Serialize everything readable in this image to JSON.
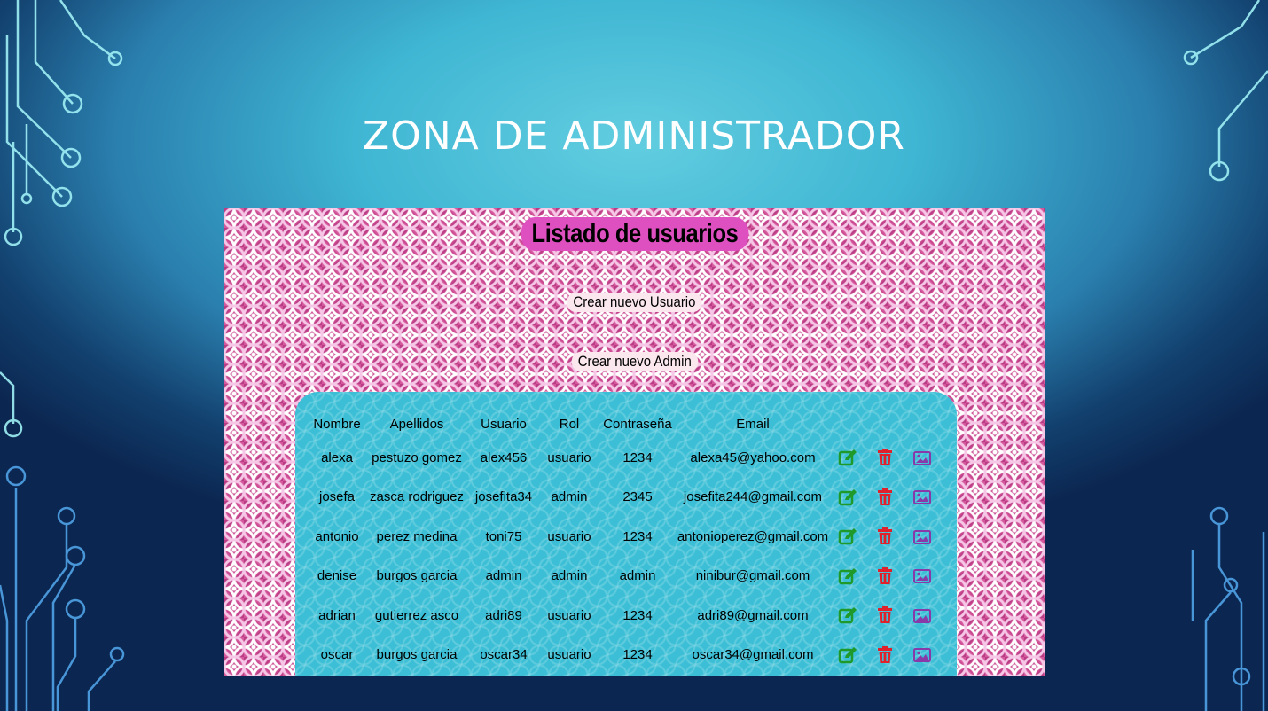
{
  "slide": {
    "title": "ZONA DE ADMINISTRADOR"
  },
  "page": {
    "heading": "Listado de usuarios",
    "create_user_label": "Crear nuevo Usuario",
    "create_admin_label": "Crear nuevo Admin"
  },
  "table": {
    "headers": {
      "nombre": "Nombre",
      "apellidos": "Apellidos",
      "usuario": "Usuario",
      "rol": "Rol",
      "contrasena": "Contraseña",
      "email": "Email"
    },
    "rows": [
      {
        "nombre": "alexa",
        "apellidos": "pestuzo gomez",
        "usuario": "alex456",
        "rol": "usuario",
        "contrasena": "1234",
        "email": "alexa45@yahoo.com"
      },
      {
        "nombre": "josefa",
        "apellidos": "zasca rodriguez",
        "usuario": "josefita34",
        "rol": "admin",
        "contrasena": "2345",
        "email": "josefita244@gmail.com"
      },
      {
        "nombre": "antonio",
        "apellidos": "perez medina",
        "usuario": "toni75",
        "rol": "usuario",
        "contrasena": "1234",
        "email": "antonioperez@gmail.com"
      },
      {
        "nombre": "denise",
        "apellidos": "burgos garcia",
        "usuario": "admin",
        "rol": "admin",
        "contrasena": "admin",
        "email": "ninibur@gmail.com"
      },
      {
        "nombre": "adrian",
        "apellidos": "gutierrez asco",
        "usuario": "adri89",
        "rol": "usuario",
        "contrasena": "1234",
        "email": "adri89@gmail.com"
      },
      {
        "nombre": "oscar",
        "apellidos": "burgos garcia",
        "usuario": "oscar34",
        "rol": "usuario",
        "contrasena": "1234",
        "email": "oscar34@gmail.com"
      }
    ],
    "row_actions": [
      "edit-icon",
      "trash-icon",
      "image-icon"
    ]
  },
  "colors": {
    "edit": "#1f9a2a",
    "delete": "#e0202a",
    "image": "#8a3aa8",
    "heading_pill": "#de4fc0",
    "panel": "#3cbfd6"
  }
}
